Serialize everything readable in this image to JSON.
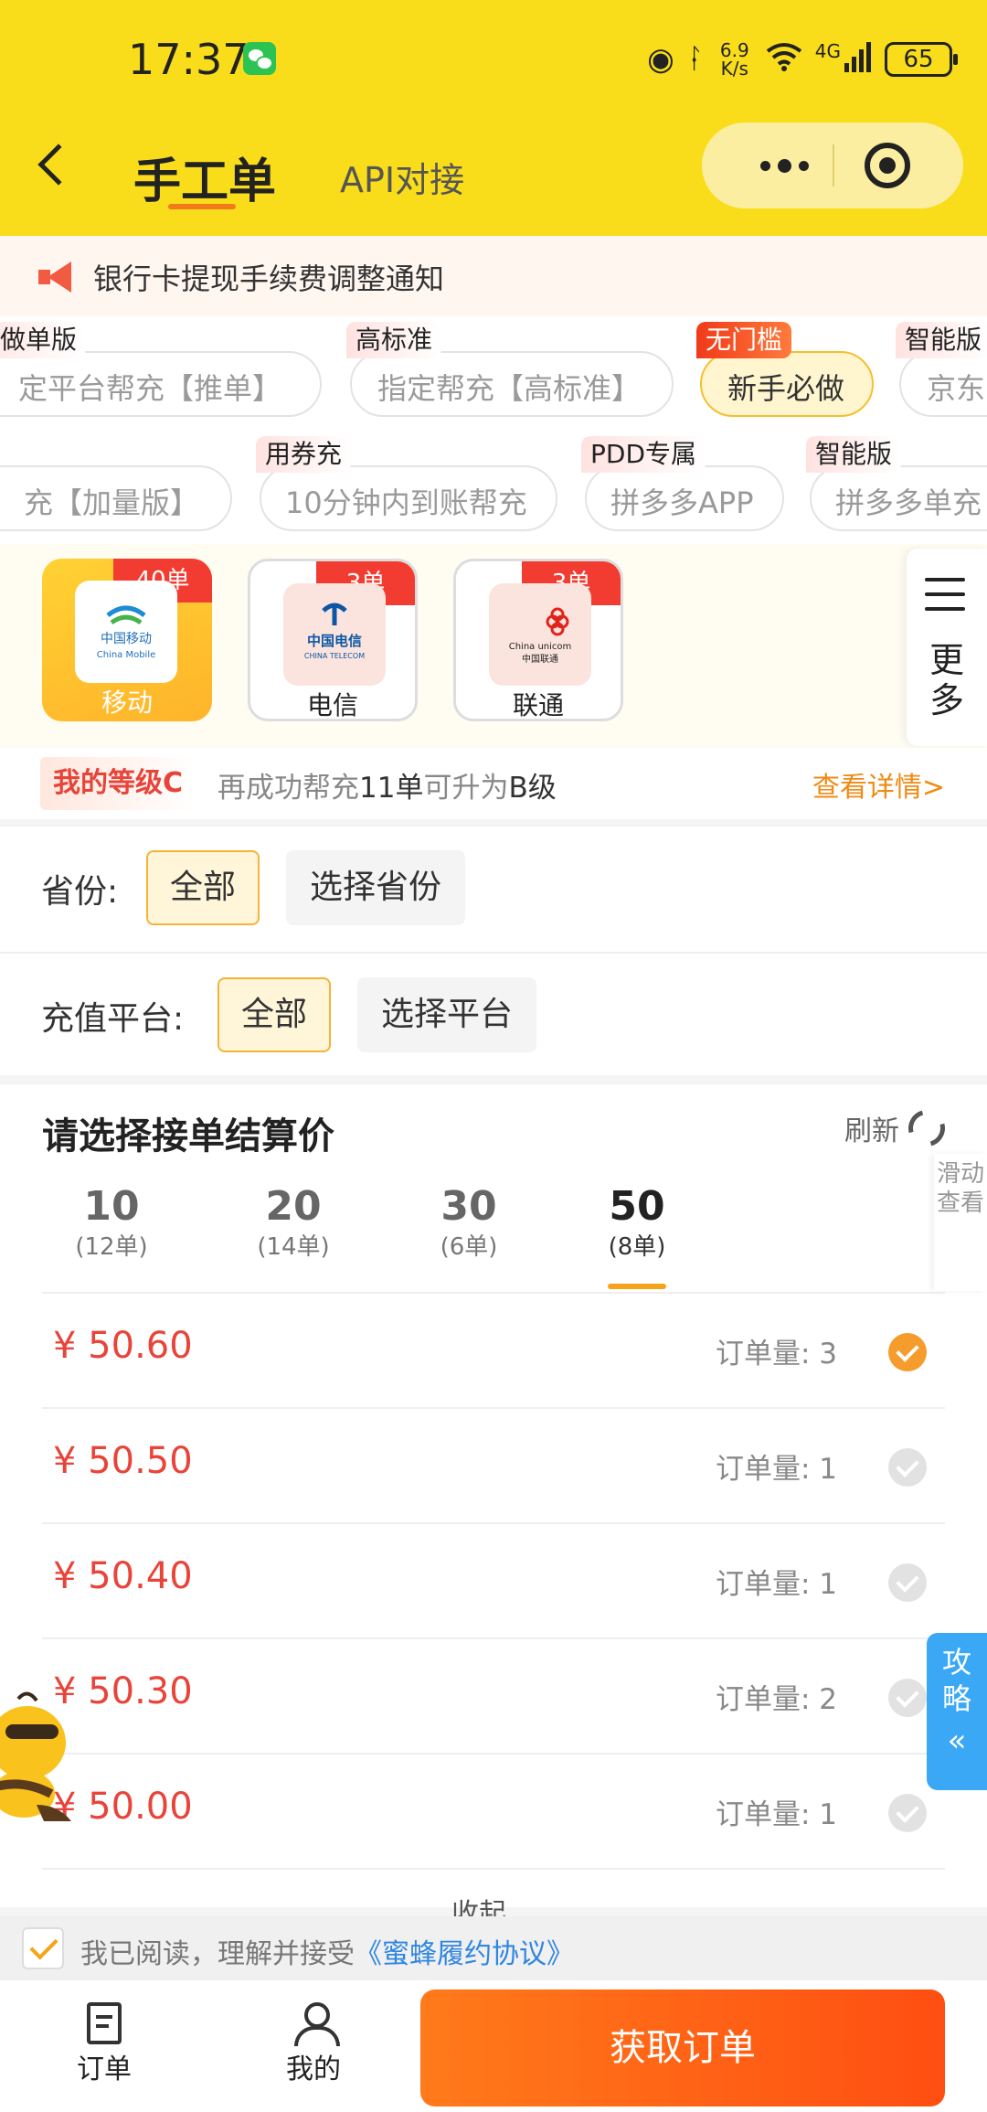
{
  "status": {
    "time": "17:37",
    "net_speed_value": "6.9",
    "net_speed_unit": "K/s",
    "network": "4G",
    "battery": "65"
  },
  "header": {
    "title": "手工单",
    "tab_api": "API对接"
  },
  "notice": {
    "text": "银行卡提现手续费调整通知"
  },
  "tags_row1": [
    {
      "badge": "套做单版",
      "label": "定平台帮充【推单】"
    },
    {
      "badge": "高标准",
      "label": "指定帮充【高标准】"
    },
    {
      "badge": "无门槛",
      "label": "新手必做"
    },
    {
      "badge": "智能版",
      "label": "京东"
    }
  ],
  "tags_row2": [
    {
      "label": "充【加量版】"
    },
    {
      "badge": "用券充",
      "label": "10分钟内到账帮充"
    },
    {
      "badge": "PDD专属",
      "label": "拼多多APP"
    },
    {
      "badge": "智能版",
      "label": "拼多多单充"
    }
  ],
  "operators": [
    {
      "name": "移动",
      "badge": "40单",
      "logo_cn": "中国移动",
      "logo_en": "China Mobile"
    },
    {
      "name": "电信",
      "badge": "3单",
      "logo_cn": "中国电信",
      "logo_en": "CHINA TELECOM"
    },
    {
      "name": "联通",
      "badge": "3单",
      "logo_cn": "中国联通",
      "logo_en": "China unicom"
    }
  ],
  "more_panel": {
    "label": "更多"
  },
  "level": {
    "tag": "我的等级C",
    "text_prefix": "再成功帮充",
    "text_count": "11单",
    "text_mid": "可升为",
    "text_target": "B级",
    "link": "查看详情>"
  },
  "filters": {
    "province_label": "省份:",
    "province_all": "全部",
    "province_select": "选择省份",
    "platform_label": "充值平台:",
    "platform_all": "全部",
    "platform_select": "选择平台"
  },
  "price_section": {
    "title": "请选择接单结算价",
    "refresh": "刷新",
    "slide_hint": "滑动查看",
    "tabs": [
      {
        "value": "10",
        "count": "(12单)"
      },
      {
        "value": "20",
        "count": "(14单)"
      },
      {
        "value": "30",
        "count": "(6单)"
      },
      {
        "value": "50",
        "count": "(8单)"
      }
    ],
    "active_tab": 3,
    "rows": [
      {
        "price": "¥ 50.60",
        "qty_label": "订单量:",
        "qty": "3",
        "checked": true
      },
      {
        "price": "¥ 50.50",
        "qty_label": "订单量:",
        "qty": "1",
        "checked": false
      },
      {
        "price": "¥ 50.40",
        "qty_label": "订单量:",
        "qty": "1",
        "checked": false
      },
      {
        "price": "¥ 50.30",
        "qty_label": "订单量:",
        "qty": "2",
        "checked": false
      },
      {
        "price": "¥ 50.00",
        "qty_label": "订单量:",
        "qty": "1",
        "checked": false
      }
    ],
    "collapse": "收起"
  },
  "guide_tab": {
    "label": "攻略",
    "arrow": "«"
  },
  "agreement": {
    "text": "我已阅读，理解并接受",
    "link": "《蜜蜂履约协议》"
  },
  "bottom_nav": {
    "orders": "订单",
    "mine": "我的",
    "get_order": "获取订单"
  },
  "colors": {
    "header_bg": "#f9dd1b",
    "accent_orange": "#ff5a14",
    "price_red": "#e8443a",
    "link_blue": "#2f86e0"
  }
}
